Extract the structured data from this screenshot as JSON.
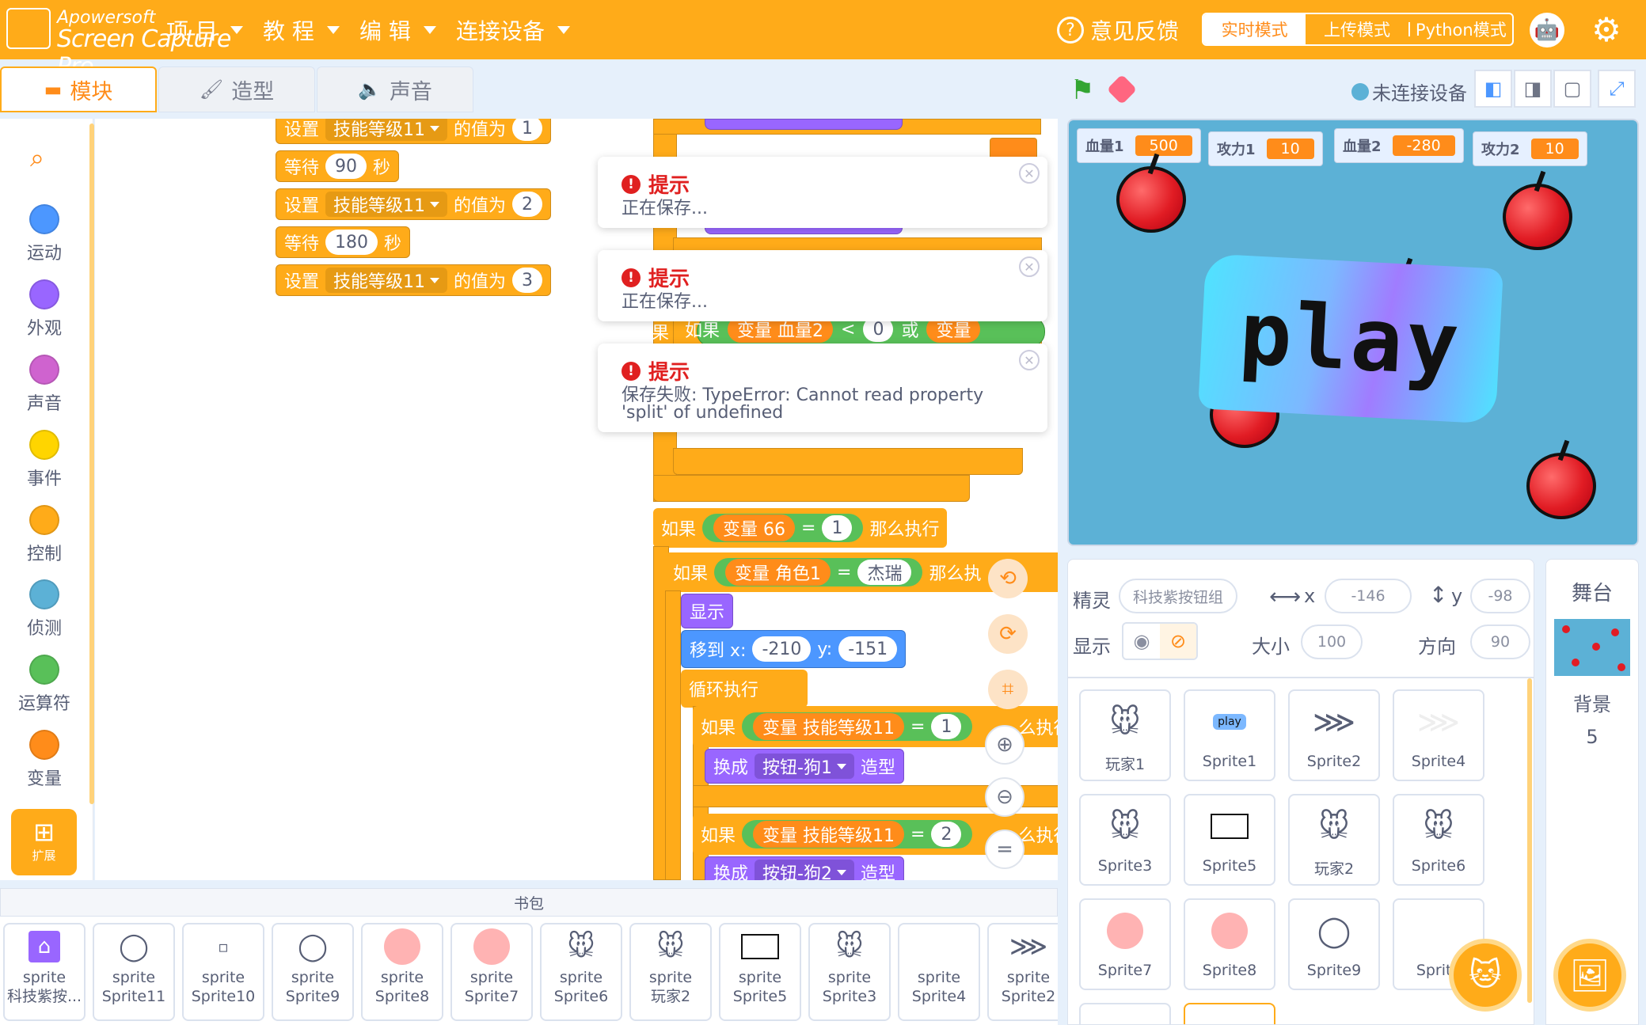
{
  "menubar": {
    "logo_line1": "Apowersoft",
    "logo_line2": "Screen Capture Pro",
    "menu": [
      "项 目",
      "教 程",
      "编 辑",
      "连接设备"
    ],
    "feedback": "意见反馈",
    "modes": [
      "实时模式",
      "上传模式",
      "Python模式"
    ],
    "active_mode": "实时模式"
  },
  "tabs": [
    "模块",
    "造型",
    "声音"
  ],
  "categories": [
    {
      "label": "运动",
      "color": "#4c97ff"
    },
    {
      "label": "外观",
      "color": "#9966ff"
    },
    {
      "label": "声音",
      "color": "#cf63cf"
    },
    {
      "label": "事件",
      "color": "#ffd500"
    },
    {
      "label": "控制",
      "color": "#ffab19"
    },
    {
      "label": "侦测",
      "color": "#5cb1d6"
    },
    {
      "label": "运算符",
      "color": "#59c059"
    },
    {
      "label": "变量",
      "color": "#ff8c1a"
    }
  ],
  "extension_label": "扩展",
  "script": {
    "set1": {
      "verb": "设置",
      "var": "技能等级11",
      "mid": "的值为",
      "val": "1"
    },
    "wait1": {
      "verb": "等待",
      "val": "90",
      "unit": "秒"
    },
    "set2": {
      "verb": "设置",
      "var": "技能等级11",
      "mid": "的值为",
      "val": "2"
    },
    "wait2": {
      "verb": "等待",
      "val": "180",
      "unit": "秒"
    },
    "set3": {
      "verb": "设置",
      "var": "技能等级11",
      "mid": "的值为",
      "val": "3"
    },
    "if_partial": {
      "kw": "如果",
      "var": "变量 血量2",
      "op": "<",
      "val": "0",
      "or": "或",
      "var2": "变量"
    },
    "if66": {
      "kw": "如果",
      "var": "变量 66",
      "op": "=",
      "val": "1",
      "then": "那么执行"
    },
    "if_role": {
      "kw": "如果",
      "var": "变量 角色1",
      "op": "=",
      "val": "杰瑞",
      "then": "那么执"
    },
    "show": "显示",
    "goto": {
      "verb": "移到 x:",
      "x": "-210",
      "ylabel": "y:",
      "y": "-151"
    },
    "loop": "循环执行",
    "if_lvl1": {
      "kw": "如果",
      "var": "变量 技能等级11",
      "op": "=",
      "val": "1",
      "then": "么执行"
    },
    "switch1": {
      "verb": "换成",
      "costume": "按钮-狗1",
      "tail": "造型"
    },
    "if_lvl2": {
      "kw": "如果",
      "var": "变量 技能等级11",
      "op": "=",
      "val": "2",
      "then": "么执行"
    },
    "switch2": {
      "verb": "换成",
      "costume": "按钮-狗2",
      "tail": "造型"
    }
  },
  "toasts": [
    {
      "title": "提示",
      "body": "正在保存..."
    },
    {
      "title": "提示",
      "body": "正在保存..."
    },
    {
      "title": "提示",
      "body": "保存失败: TypeError: Cannot read property 'split' of undefined"
    }
  ],
  "backpack": {
    "title": "书包",
    "items": [
      {
        "type": "sprite",
        "name": "科技紫按...",
        "icon": "home-icon"
      },
      {
        "type": "sprite",
        "name": "Sprite11",
        "icon": "ring-icon"
      },
      {
        "type": "sprite",
        "name": "Sprite10",
        "icon": "broken-image-icon"
      },
      {
        "type": "sprite",
        "name": "Sprite9",
        "icon": "ring-icon"
      },
      {
        "type": "sprite",
        "name": "Sprite8",
        "icon": "pink-ball-icon"
      },
      {
        "type": "sprite",
        "name": "Sprite7",
        "icon": "pink-ball-icon"
      },
      {
        "type": "sprite",
        "name": "Sprite6",
        "icon": "mouse-icon"
      },
      {
        "type": "sprite",
        "name": "玩家2",
        "icon": "mouse-icon"
      },
      {
        "type": "sprite",
        "name": "Sprite5",
        "icon": "rectangle-icon"
      },
      {
        "type": "sprite",
        "name": "Sprite3",
        "icon": "mouse-icon"
      },
      {
        "type": "sprite",
        "name": "Sprite4",
        "icon": "blank-icon"
      },
      {
        "type": "sprite",
        "name": "Sprite2",
        "icon": "arrow-icon"
      }
    ]
  },
  "stage_header": {
    "connection": "未连接设备"
  },
  "monitors": [
    {
      "label": "血量1",
      "value": "500"
    },
    {
      "label": "攻力1",
      "value": "10"
    },
    {
      "label": "血量2",
      "value": "-280"
    },
    {
      "label": "攻力2",
      "value": "10"
    }
  ],
  "stage_text": "play",
  "sprite_info": {
    "sprite_label": "精灵",
    "sprite_name": "科技紫按钮组",
    "x_label": "x",
    "x": "-146",
    "y_label": "y",
    "y": "-98",
    "show_label": "显示",
    "size_label": "大小",
    "size": "100",
    "dir_label": "方向",
    "dir": "90"
  },
  "sprites": [
    "玩家1",
    "Sprite1",
    "Sprite2",
    "Sprite4",
    "Sprite3",
    "Sprite5",
    "玩家2",
    "Sprite6",
    "Sprite7",
    "Sprite8",
    "Sprite9",
    "Sprite"
  ],
  "stage_panel": {
    "title": "舞台",
    "bg_label": "背景",
    "bg_count": "5"
  },
  "colors": {
    "accent": "#ffab19",
    "menubar": "#ffab19",
    "error": "#e02020"
  }
}
